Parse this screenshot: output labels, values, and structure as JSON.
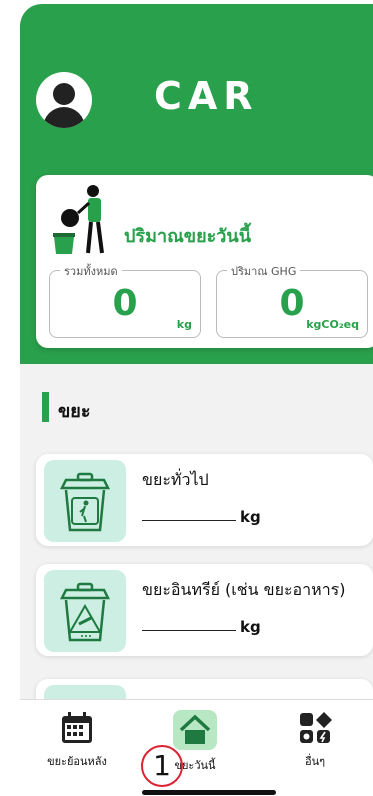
{
  "app": {
    "title": "CAR"
  },
  "summary": {
    "title": "ปริมาณขยะวันนี้",
    "total": {
      "legend": "รวมทั้งหมด",
      "value": "0",
      "unit": "kg"
    },
    "ghg": {
      "legend": "ปริมาณ GHG",
      "value": "0",
      "unit": "kgCO₂eq"
    }
  },
  "section": {
    "label": "ขยะ"
  },
  "waste_items": [
    {
      "name": "ขยะทั่วไป",
      "unit": "kg",
      "icon": "general-bin-icon"
    },
    {
      "name": "ขยะอินทรีย์ (เช่น ขยะอาหาร)",
      "unit": "kg",
      "icon": "organic-bin-icon"
    }
  ],
  "tabs": [
    {
      "label": "ขยะย้อนหลัง",
      "icon": "calendar-icon"
    },
    {
      "label": "ขยะวันนี้",
      "icon": "home-icon",
      "active": true
    },
    {
      "label": "อื่นๆ",
      "icon": "more-icon"
    }
  ],
  "annotation": {
    "step": "1"
  },
  "colors": {
    "primary": "#29a04b",
    "tile": "#cdeee2",
    "active_tab_bg": "#b8e7c3"
  }
}
